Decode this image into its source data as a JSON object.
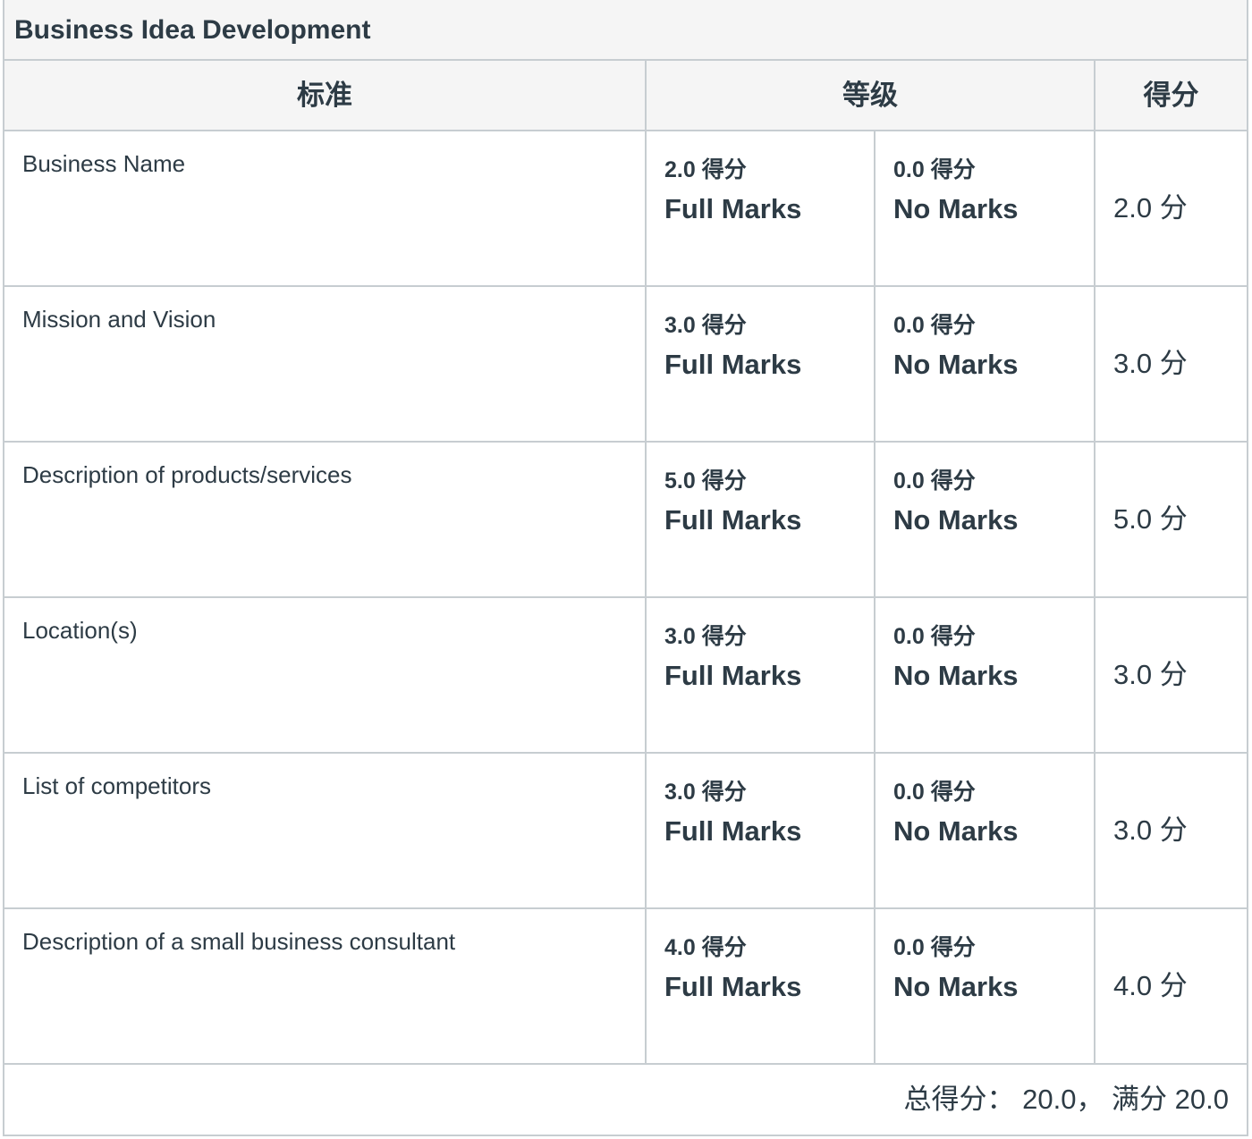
{
  "rubric": {
    "title": "Business Idea Development",
    "headers": {
      "criteria": "标准",
      "ratings": "等级",
      "points": "得分"
    },
    "criteria": [
      {
        "description": "Business Name",
        "ratings": [
          {
            "points": "2.0 得分",
            "description": "Full Marks"
          },
          {
            "points": "0.0 得分",
            "description": "No Marks"
          }
        ],
        "score": "2.0 分"
      },
      {
        "description": "Mission and Vision",
        "ratings": [
          {
            "points": "3.0 得分",
            "description": "Full Marks"
          },
          {
            "points": "0.0 得分",
            "description": "No Marks"
          }
        ],
        "score": "3.0 分"
      },
      {
        "description": "Description of products/services",
        "ratings": [
          {
            "points": "5.0 得分",
            "description": "Full Marks"
          },
          {
            "points": "0.0 得分",
            "description": "No Marks"
          }
        ],
        "score": "5.0 分"
      },
      {
        "description": "Location(s)",
        "ratings": [
          {
            "points": "3.0 得分",
            "description": "Full Marks"
          },
          {
            "points": "0.0 得分",
            "description": "No Marks"
          }
        ],
        "score": "3.0 分"
      },
      {
        "description": "List of competitors",
        "ratings": [
          {
            "points": "3.0 得分",
            "description": "Full Marks"
          },
          {
            "points": "0.0 得分",
            "description": "No Marks"
          }
        ],
        "score": "3.0 分"
      },
      {
        "description": "Description of a small business consultant",
        "ratings": [
          {
            "points": "4.0 得分",
            "description": "Full Marks"
          },
          {
            "points": "0.0 得分",
            "description": "No Marks"
          }
        ],
        "score": "4.0 分"
      }
    ],
    "total": "总得分： 20.0， 满分 20.0"
  }
}
